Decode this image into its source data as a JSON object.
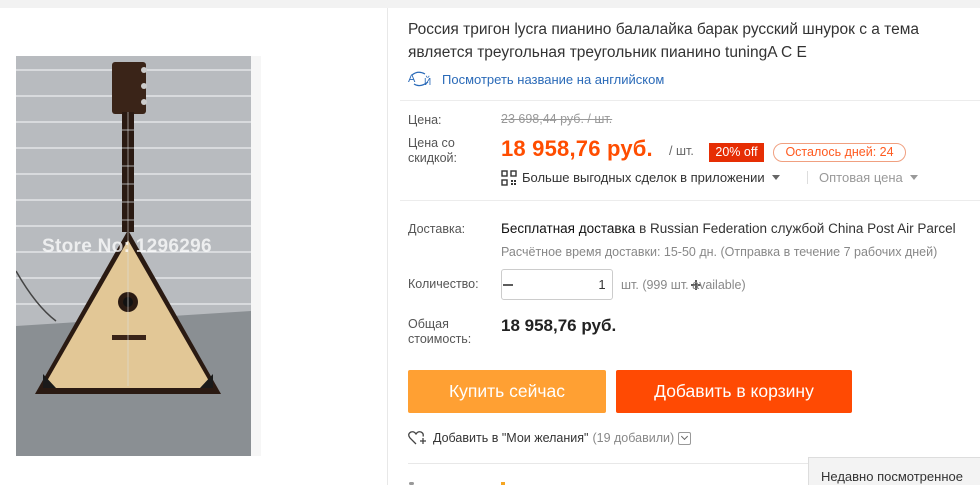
{
  "product": {
    "title": "Россия тригон lycra пианино балалайка барак русский шнурок с а тема является треугольная треугольник пианино tuningA C E",
    "translate_link": "Посмотреть название на английском",
    "image_watermark": "Store No: 1296296"
  },
  "pricing": {
    "price_label": "Цена:",
    "old_price": "23 698,44 руб. / шт.",
    "sale_label": "Цена со скидкой:",
    "sale_price": "18 958,76 руб.",
    "per_unit": "/ шт.",
    "discount_badge": "20% off",
    "days_left": "Осталось дней: 24",
    "app_deals": "Больше выгодных сделок в приложении",
    "wholesale": "Оптовая цена"
  },
  "delivery": {
    "label": "Доставка:",
    "free_text": "Бесплатная доставка",
    "in_text": "в",
    "country": "Russian Federation",
    "service_text": "службой",
    "carrier": "China Post Air Parcel",
    "estimate": "Расчётное время доставки: 15-50 дн. (Отправка в течение 7 рабочих дней)"
  },
  "quantity": {
    "label": "Количество:",
    "value": "1",
    "available": "шт. (999 шт. available)"
  },
  "total": {
    "label": "Общая стоимость:",
    "value": "18 958,76 руб."
  },
  "actions": {
    "buy_now": "Купить сейчас",
    "add_to_cart": "Добавить в корзину",
    "wishlist": "Добавить в \"Мои желания\"",
    "wishlist_count": "(19 добавили)"
  },
  "recently_viewed": "Недавно посмотренное",
  "colors": {
    "sale_price": "#ff4d00",
    "discount_badge": "#e62e04",
    "buy_now": "#ffa033",
    "add_to_cart": "#ff4a03",
    "link": "#2a6ab8"
  }
}
